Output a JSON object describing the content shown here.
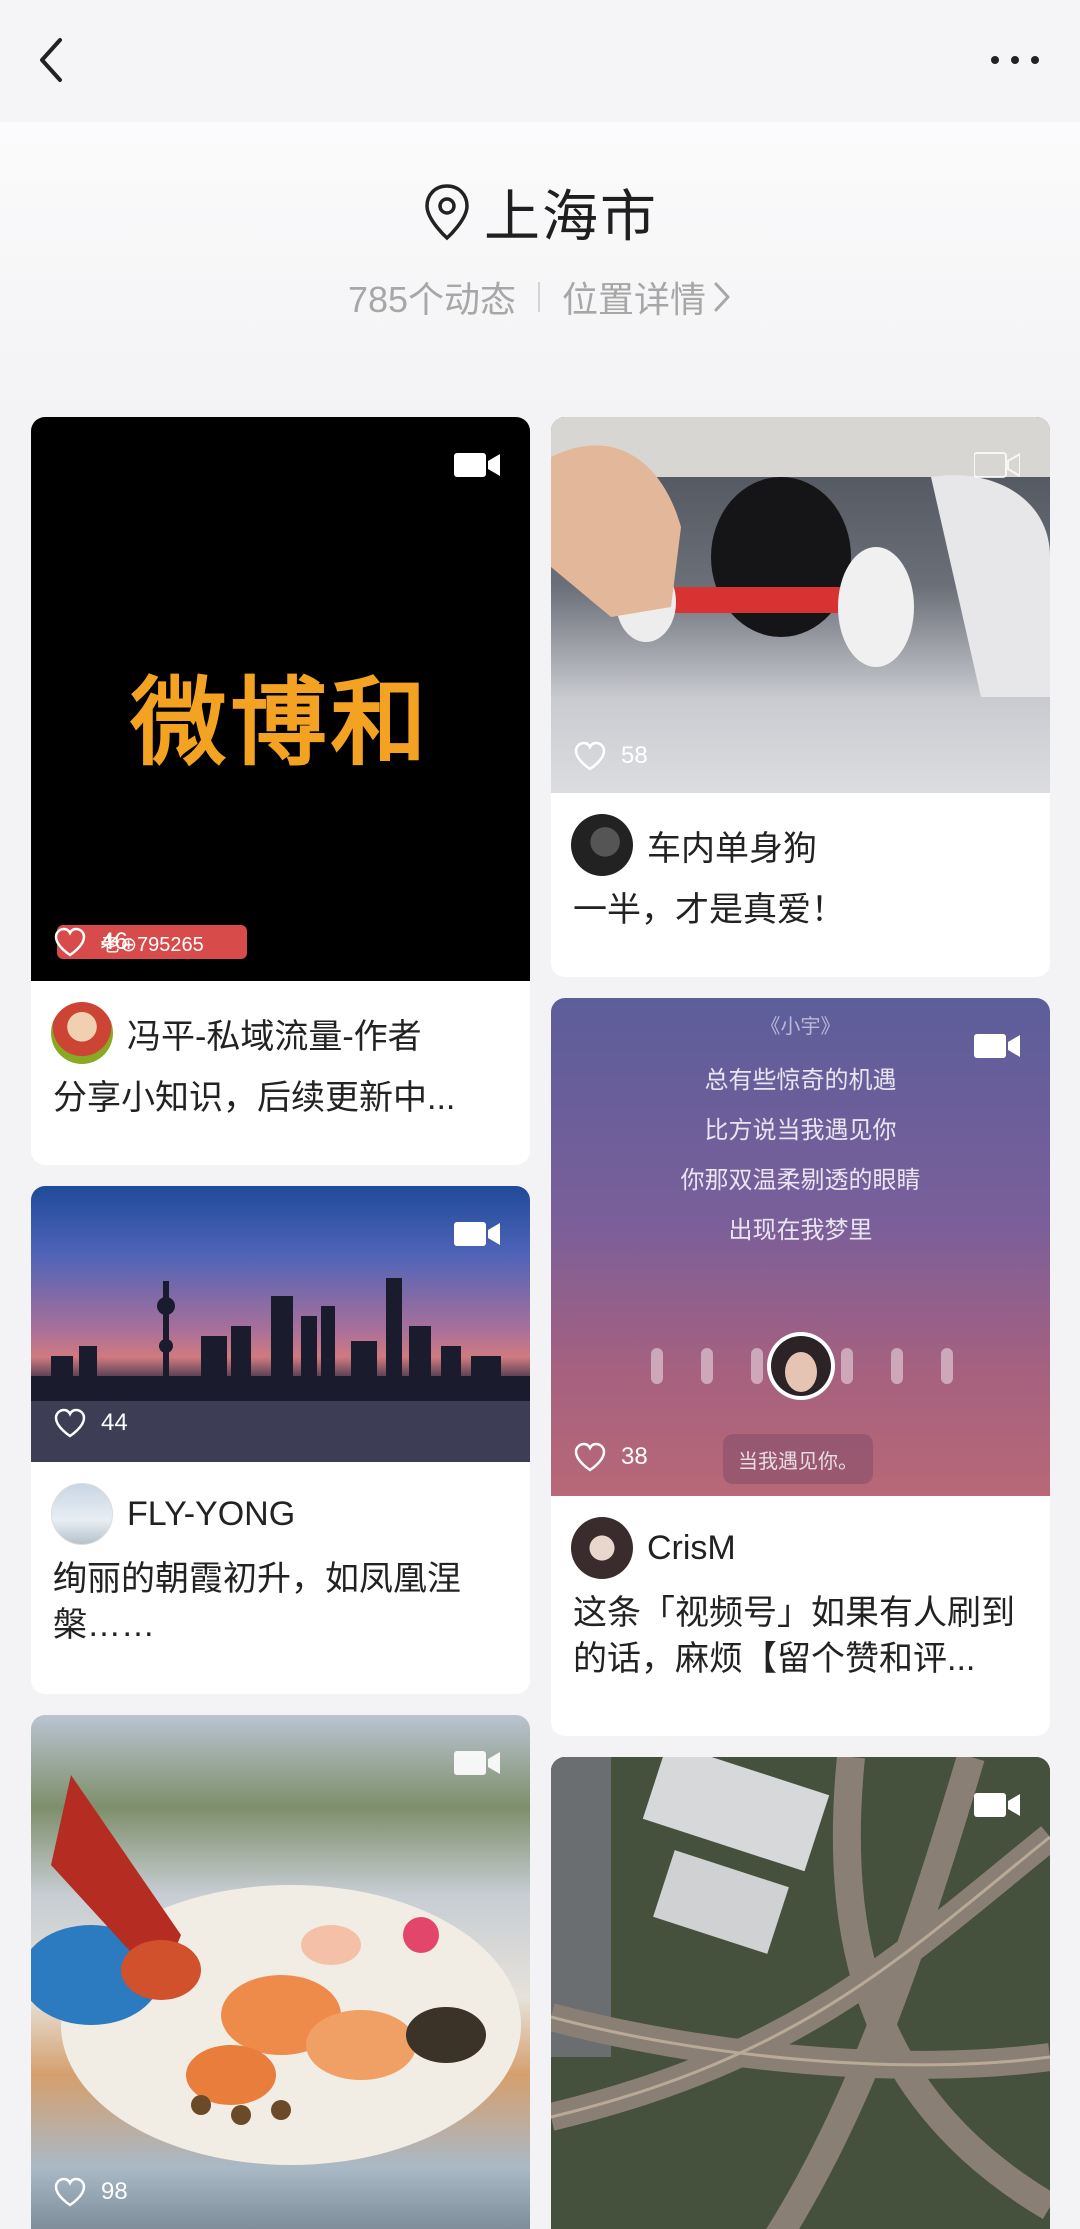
{
  "topbar": {
    "back_icon": "chevron-left-icon",
    "more_icon": "more-dots-icon"
  },
  "header": {
    "location_icon": "location-pin-icon",
    "title": "上海市",
    "post_count": "785个动态",
    "detail_link": "位置详情"
  },
  "feed": {
    "left": [
      {
        "media_text": "微博和",
        "watermark": "老⊕795265",
        "likes": "46",
        "author": "冯平-私域流量-作者",
        "caption": "分享小知识，后续更新中..."
      },
      {
        "likes": "44",
        "author": "FLY-YONG",
        "caption": "绚丽的朝霞初升，如凤凰涅槃……"
      },
      {
        "likes": "98"
      }
    ],
    "right": [
      {
        "likes": "58",
        "author": "车内单身狗",
        "caption": "一半，才是真爱！"
      },
      {
        "song_title": "《小宇》",
        "lyrics": [
          "总有些惊奇的机遇",
          "比方说当我遇见你",
          "你那双温柔剔透的眼睛",
          "出现在我梦里"
        ],
        "bubble": "当我遇见你。",
        "likes": "38",
        "author": "CrisM",
        "caption": "这条「视频号」如果有人刷到的话，麻烦【留个赞和评..."
      },
      {}
    ]
  },
  "colors": {
    "accent_orange": "#f3a222",
    "page_bg": "#f3f3f5",
    "card_bg": "#ffffff"
  }
}
